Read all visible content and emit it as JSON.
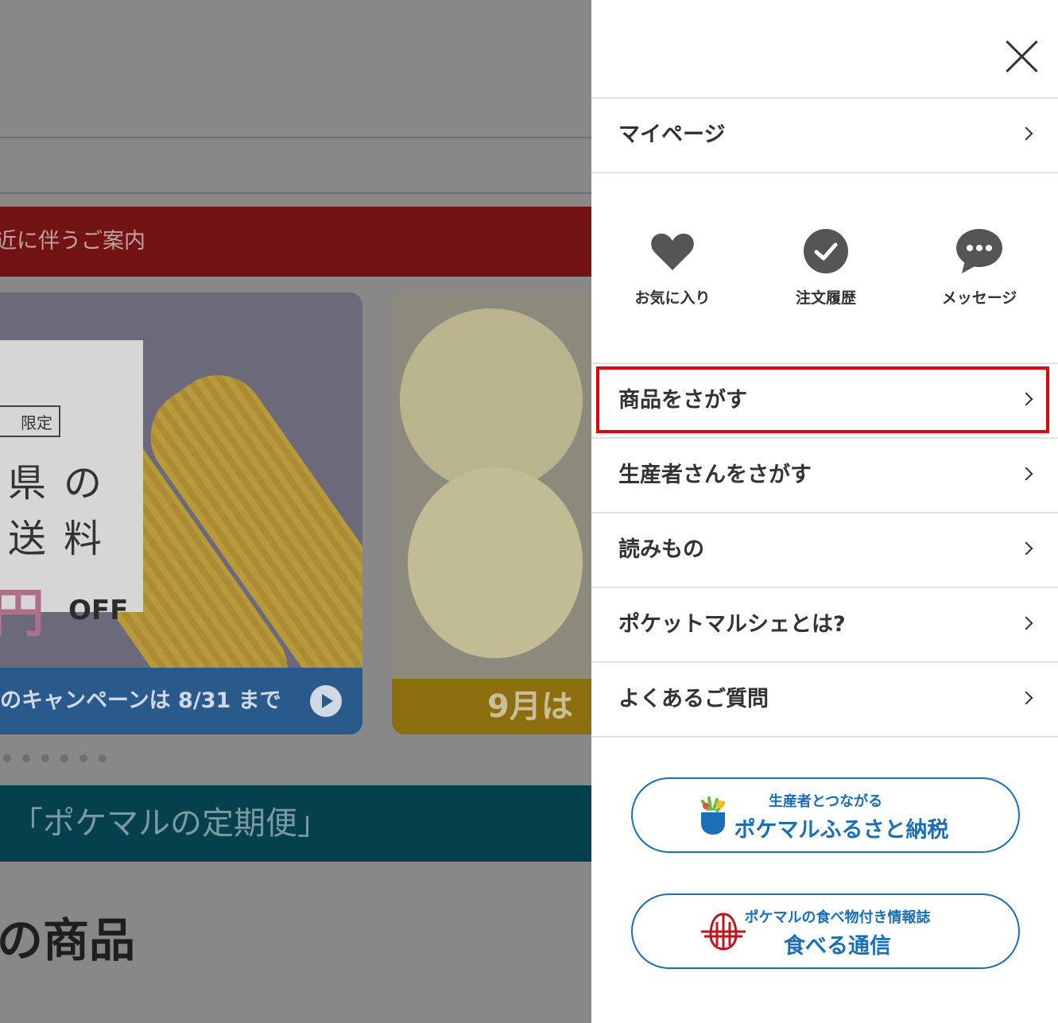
{
  "background": {
    "notice_text": "近に伴うご案内",
    "card1": {
      "tag": "限定",
      "line1": "県の",
      "line2": "送料",
      "price": "円",
      "off": "OFF",
      "footer": "のキャンペーンは 8/31 まで"
    },
    "card2": {
      "footer": "9月は"
    },
    "banner_text": "「ポケマルの定期便」",
    "heading": "の商品"
  },
  "drawer": {
    "mypage_label": "マイページ",
    "quick_links": [
      {
        "label": "お気に入り",
        "icon": "heart-icon"
      },
      {
        "label": "注文履歴",
        "icon": "check-circle-icon"
      },
      {
        "label": "メッセージ",
        "icon": "chat-bubble-icon"
      }
    ],
    "menu": [
      {
        "label": "商品をさがす"
      },
      {
        "label": "生産者さんをさがす"
      },
      {
        "label": "読みもの"
      },
      {
        "label": "ポケットマルシェとは?"
      },
      {
        "label": "よくあるご質問"
      }
    ],
    "furusato": {
      "small": "生産者とつながる",
      "big": "ポケマルふるさと納税"
    },
    "taberu": {
      "small": "ポケマルの食べ物付き情報誌",
      "big": "食べる通信"
    }
  },
  "colors": {
    "accent_blue": "#1a6fb8",
    "highlight_red": "#e1000f",
    "icon_gray": "#555555"
  }
}
